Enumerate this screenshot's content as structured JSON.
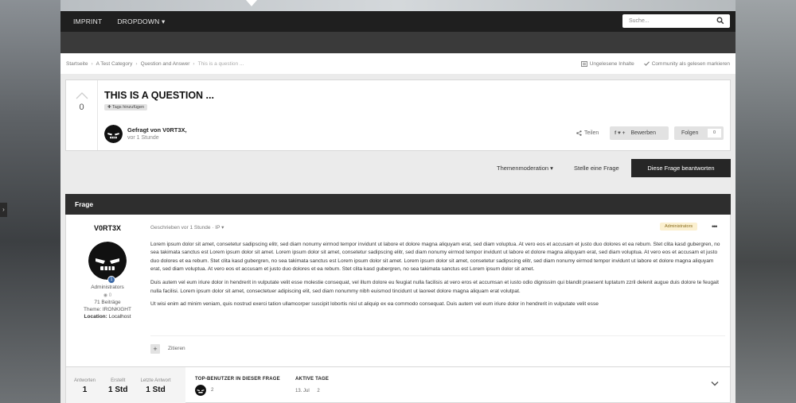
{
  "nav": {
    "items": [
      "IMPRINT",
      "DROPDOWN"
    ],
    "search_placeholder": "Suche..."
  },
  "breadcrumb": {
    "items": [
      "Startseite",
      "A Test Category",
      "Question and Answer"
    ],
    "current": "This is a question ...",
    "unread": "Ungelesene Inhalte",
    "mark_read": "Community als gelesen markieren"
  },
  "question": {
    "votes": "0",
    "title": "THIS IS A QUESTION ...",
    "add_tags": "Tags hinzufügen",
    "asked_by": "Gefragt von V0RT3X,",
    "asked_time": "vor 1 Stunde",
    "share": "Teilen",
    "rate_social": "f ♥ +",
    "rate": "Bewerben",
    "follow": "Folgen",
    "follow_count": "0"
  },
  "actions": {
    "moderation": "Themenmoderation ▾",
    "ask": "Stelle eine Frage",
    "answer": "Diese Frage beantworten"
  },
  "section": {
    "title": "Frage"
  },
  "post": {
    "author": "V0RT3X",
    "rank": "1",
    "group": "Administrators",
    "reputation": "◉ 0",
    "posts": "71 Beiträge",
    "theme": "Theme: IRONKIGHT",
    "location_label": "Location:",
    "location_value": "Localhost",
    "meta": "Geschrieben vor 1 Stunde · IP ▾",
    "badge": "Administrators",
    "more": "•••",
    "paragraphs": [
      "Lorem ipsum dolor sit amet, consetetur sadipscing elitr, sed diam nonumy eirmod tempor invidunt ut labore et dolore magna aliquyam erat, sed diam voluptua. At vero eos et accusam et justo duo dolores et ea rebum. Stet clita kasd gubergren, no sea takimata sanctus est Lorem ipsum dolor sit amet. Lorem ipsum dolor sit amet, consetetur sadipscing elitr, sed diam nonumy eirmod tempor invidunt ut labore et dolore magna aliquyam erat, sed diam voluptua. At vero eos et accusam et justo duo dolores et ea rebum. Stet clita kasd gubergren, no sea takimata sanctus est Lorem ipsum dolor sit amet. Lorem ipsum dolor sit amet, consetetur sadipscing elitr, sed diam nonumy eirmod tempor invidunt ut labore et dolore magna aliquyam erat, sed diam voluptua. At vero eos et accusam et justo duo dolores et ea rebum. Stet clita kasd gubergren, no sea takimata sanctus est Lorem ipsum dolor sit amet.",
      "Duis autem vel eum iriure dolor in hendrerit in vulputate velit esse molestie consequat, vel illum dolore eu feugiat nulla facilisis at vero eros et accumsan et iusto odio dignissim qui blandit praesent luptatum zzril delenit augue duis dolore te feugait nulla facilisi. Lorem ipsum dolor sit amet, consectetuer adipiscing elit, sed diam nonummy nibh euismod tincidunt ut laoreet dolore magna aliquam erat volutpat.",
      "Ut wisi enim ad minim veniam, quis nostrud exerci tation ullamcorper suscipit lobortis nisl ut aliquip ex ea commodo consequat. Duis autem vel eum iriure dolor in hendrerit in vulputate velit esse"
    ],
    "quote_plus": "+",
    "quote": "Zitieren"
  },
  "stats": {
    "answers_label": "Antworten",
    "answers": "1",
    "created_label": "Erstellt",
    "created": "1 Std",
    "last_label": "Letzte Antwort",
    "last": "1 Std",
    "top_users_title": "TOP-BENUTZER IN DIESER FRAGE",
    "top_user_count": "2",
    "active_days_title": "AKTIVE TAGE",
    "active_day": "13. Jul",
    "active_day_count": "2"
  }
}
